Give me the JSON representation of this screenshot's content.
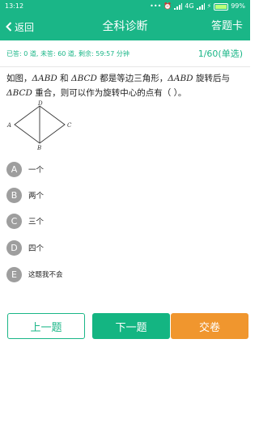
{
  "status_bar": {
    "time": "13:12",
    "network": "4G",
    "battery": "99%",
    "battery_level": 0.99
  },
  "nav": {
    "back_label": "返回",
    "title": "全科诊断",
    "answer_card_label": "答题卡"
  },
  "progress": {
    "stats": "已答: 0 道, 未答: 60 道, 剩余: 59:57 分钟",
    "position": "1/60(单选)"
  },
  "question": {
    "t1": "如图，",
    "m1": "ΔABD",
    "t2": " 和 ",
    "m2": "ΔBCD",
    "t3": " 都是等边三角形，",
    "m3": "ΔABD",
    "t4": " 旋转后与",
    "m4": "ΔBCD",
    "t5": " 重合，则可以作为旋转中心的点有（ ）。",
    "figure_labels": {
      "A": "A",
      "B": "B",
      "C": "C",
      "D": "D"
    }
  },
  "options": [
    {
      "letter": "A",
      "text": "一个"
    },
    {
      "letter": "B",
      "text": "两个"
    },
    {
      "letter": "C",
      "text": "三个"
    },
    {
      "letter": "D",
      "text": "四个"
    },
    {
      "letter": "E",
      "text": "这题我不会"
    }
  ],
  "buttons": {
    "prev": "上一题",
    "next": "下一题",
    "submit": "交卷"
  },
  "colors": {
    "accent": "#1ab687",
    "submit": "#f0962e",
    "option_circle": "#9e9e9e"
  }
}
